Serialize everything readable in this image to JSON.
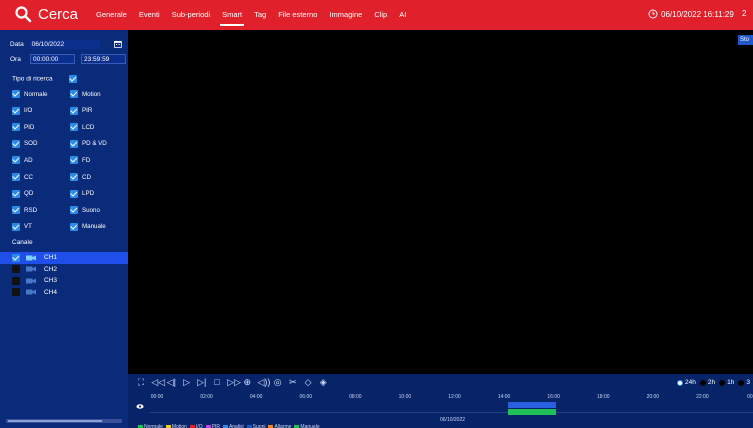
{
  "app": {
    "title": "Cerca"
  },
  "tabs": [
    {
      "label": "Generale"
    },
    {
      "label": "Eventi"
    },
    {
      "label": "Sub-periodi"
    },
    {
      "label": "Smart",
      "active": true
    },
    {
      "label": "Tag"
    },
    {
      "label": "File esterno"
    },
    {
      "label": "Immagine"
    },
    {
      "label": "Clip"
    },
    {
      "label": "AI"
    }
  ],
  "clock": {
    "datetime": "06/10/2022 16:11:29",
    "tail": "2"
  },
  "sidebar": {
    "date_label": "Data",
    "date_value": "06/10/2022",
    "time_label": "Ora",
    "time_start": "00:00:00",
    "time_end": "23:59:59",
    "search_type_label": "Tipo di ricerca",
    "types": [
      {
        "label": "Normale",
        "checked": true
      },
      {
        "label": "Motion",
        "checked": true
      },
      {
        "label": "I/O",
        "checked": true
      },
      {
        "label": "PIR",
        "checked": true
      },
      {
        "label": "PID",
        "checked": true
      },
      {
        "label": "LCD",
        "checked": true
      },
      {
        "label": "SOD",
        "checked": true
      },
      {
        "label": "PD & VD",
        "checked": true
      },
      {
        "label": "AD",
        "checked": true
      },
      {
        "label": "FD",
        "checked": true
      },
      {
        "label": "CC",
        "checked": true
      },
      {
        "label": "CD",
        "checked": true
      },
      {
        "label": "QD",
        "checked": true
      },
      {
        "label": "LPD",
        "checked": true
      },
      {
        "label": "RSD",
        "checked": true
      },
      {
        "label": "Suono",
        "checked": true
      },
      {
        "label": "VT",
        "checked": true
      },
      {
        "label": "Manuale",
        "checked": true
      }
    ],
    "channels_label": "Canale",
    "channels": [
      {
        "label": "CH1",
        "checked": true,
        "selected": true
      },
      {
        "label": "CH2",
        "checked": false
      },
      {
        "label": "CH3",
        "checked": false
      },
      {
        "label": "CH4",
        "checked": false
      }
    ]
  },
  "video": {
    "stop_label": "Sto"
  },
  "zoom": {
    "options": [
      {
        "label": "24h",
        "selected": true
      },
      {
        "label": "2h"
      },
      {
        "label": "1h"
      },
      {
        "label": "3"
      }
    ]
  },
  "timeline": {
    "ticks": [
      "00:00",
      "02:00",
      "04:00",
      "06:00",
      "08:00",
      "10:00",
      "12:00",
      "14:00",
      "16:00",
      "18:00",
      "20:00",
      "22:00",
      "00:0"
    ],
    "date": "06/10/2022",
    "legend": [
      {
        "label": "Normale",
        "color": "#1fbf5a"
      },
      {
        "label": "Motion",
        "color": "#e8d21f"
      },
      {
        "label": "I/O",
        "color": "#e0202a"
      },
      {
        "label": "PIR",
        "color": "#b54be0"
      },
      {
        "label": "Analisi",
        "color": "#2b8ce6"
      },
      {
        "label": "Suoni",
        "color": "#1f59c9"
      },
      {
        "label": "Allarme",
        "color": "#e88a1f"
      },
      {
        "label": "Manuale",
        "color": "#1fbf5a"
      }
    ]
  },
  "colors": {
    "topbar": "#e0202a",
    "sidebar": "#0a2a7a",
    "accent": "#2b8ce6"
  }
}
